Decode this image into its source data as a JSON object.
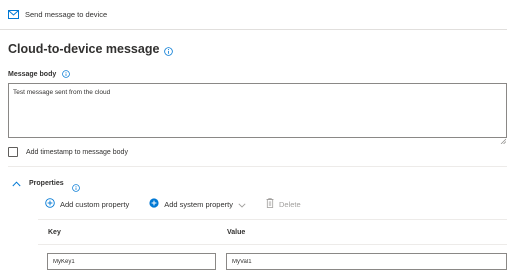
{
  "command_bar": {
    "send_label": "Send message to device",
    "send_icon": "mail-icon"
  },
  "page": {
    "title": "Cloud-to-device message"
  },
  "message_body": {
    "label": "Message body",
    "value": "Test message sent from the cloud"
  },
  "timestamp": {
    "label": "Add timestamp to message body",
    "checked": false
  },
  "properties": {
    "label": "Properties",
    "expanded": true,
    "toolbar": {
      "add_custom_label": "Add custom property",
      "add_system_label": "Add system property",
      "delete_label": "Delete"
    },
    "columns": {
      "key": "Key",
      "value": "Value"
    },
    "rows": [
      {
        "key": "MyKey1",
        "value": "MyVal1"
      }
    ]
  },
  "colors": {
    "accent": "#0078d4",
    "disabled": "#a19f9d",
    "border": "#8a8886"
  }
}
